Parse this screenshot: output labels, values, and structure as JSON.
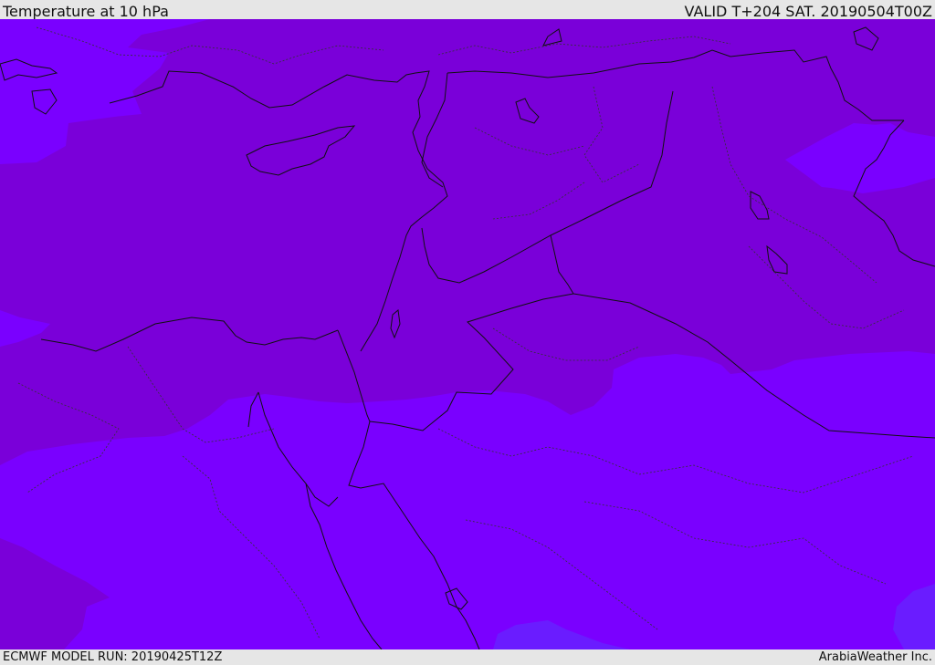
{
  "header": {
    "title": "Temperature at 10 hPa",
    "valid": "VALID T+204 SAT. 20190504T00Z"
  },
  "footer": {
    "model_run": "ECMWF MODEL RUN: 20190425T12Z",
    "brand": "ArabiaWeather Inc."
  },
  "map": {
    "colors": {
      "warm_band": "#7a00d9",
      "cold_band": "#7a00ff",
      "coldest_band": "#6a1cff",
      "coast_border": "#111111",
      "admin_border": "#333333"
    }
  }
}
